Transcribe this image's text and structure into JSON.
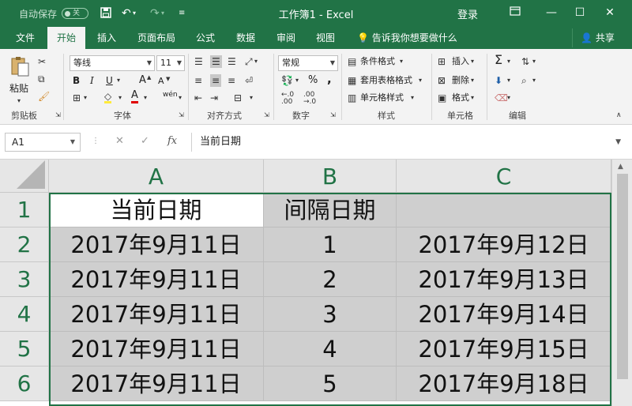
{
  "window": {
    "autosave_label": "自动保存",
    "autosave_state": "关",
    "title": "工作簿1  -  Excel",
    "login": "登录",
    "minimize": "—",
    "restore": "☐",
    "close": "✕"
  },
  "tabs": [
    "文件",
    "开始",
    "插入",
    "页面布局",
    "公式",
    "数据",
    "审阅",
    "视图"
  ],
  "active_tab_index": 1,
  "tell_me": "告诉我你想要做什么",
  "share": "共享",
  "ribbon": {
    "clipboard": {
      "paste": "粘贴",
      "label": "剪贴板"
    },
    "font": {
      "name": "等线",
      "size": "11",
      "label": "字体",
      "bold": "B",
      "italic": "I",
      "underline": "U",
      "grow": "A",
      "shrink": "A",
      "color": "A",
      "wen": "wén"
    },
    "alignment": {
      "label": "对齐方式"
    },
    "number": {
      "format": "常规",
      "label": "数字",
      "percent": "%",
      "comma": ","
    },
    "styles": {
      "conditional": "条件格式",
      "as_table": "套用表格格式",
      "cell_styles": "单元格样式",
      "label": "样式"
    },
    "cells": {
      "insert": "插入",
      "delete": "删除",
      "format": "格式",
      "label": "单元格"
    },
    "editing": {
      "label": "编辑",
      "sigma": "Σ"
    }
  },
  "formula_bar": {
    "name_box": "A1",
    "content": "当前日期"
  },
  "sheet": {
    "columns": [
      "A",
      "B",
      "C"
    ],
    "rows": [
      "1",
      "2",
      "3",
      "4",
      "5",
      "6"
    ],
    "cells": [
      [
        "当前日期",
        "间隔日期",
        ""
      ],
      [
        "2017年9月11日",
        "1",
        "2017年9月12日"
      ],
      [
        "2017年9月11日",
        "2",
        "2017年9月13日"
      ],
      [
        "2017年9月11日",
        "3",
        "2017年9月14日"
      ],
      [
        "2017年9月11日",
        "4",
        "2017年9月15日"
      ],
      [
        "2017年9月11日",
        "5",
        "2017年9月18日"
      ]
    ]
  },
  "colors": {
    "brand": "#217346",
    "ribbon_bg": "#f3f3f3",
    "cell_selected": "#cfcfcf",
    "header_bg": "#e6e6e6"
  }
}
